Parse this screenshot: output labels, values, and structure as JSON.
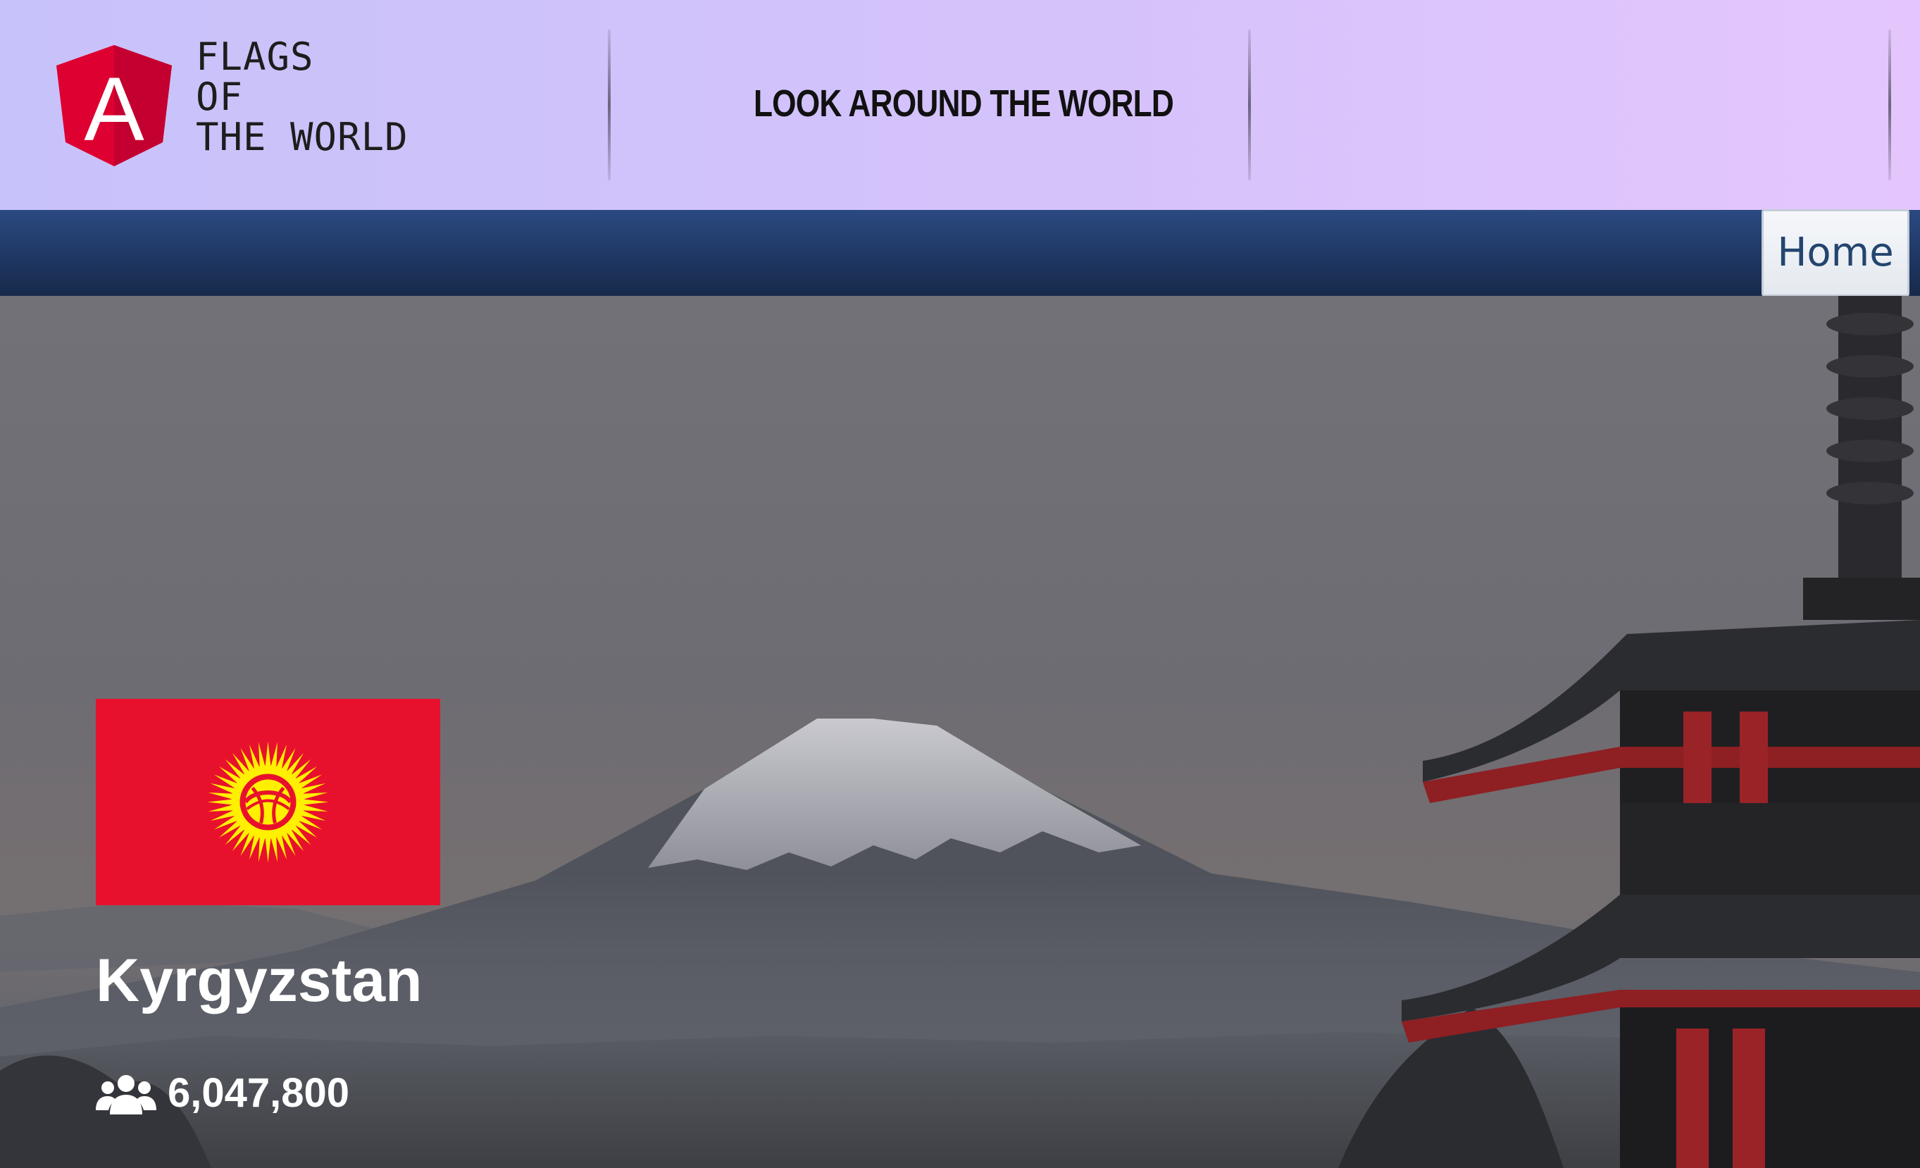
{
  "header": {
    "brand_lines": [
      "FLAGS",
      "OF",
      "THE WORLD"
    ],
    "logo_letter": "A",
    "tagline": "LOOK AROUND THE WORLD"
  },
  "nav": {
    "home_label": "Home"
  },
  "country": {
    "name": "Kyrgyzstan",
    "population": "6,047,800",
    "flag_icon": "kyrgyzstan-flag",
    "population_icon": "people-icon"
  },
  "colors": {
    "header_gradient_start": "#c8c2fa",
    "header_gradient_end": "#e4c6fc",
    "nav_blue": "#1f3763",
    "logo_red": "#dd0031",
    "flag_red": "#e8112d",
    "flag_yellow": "#ffef00"
  }
}
